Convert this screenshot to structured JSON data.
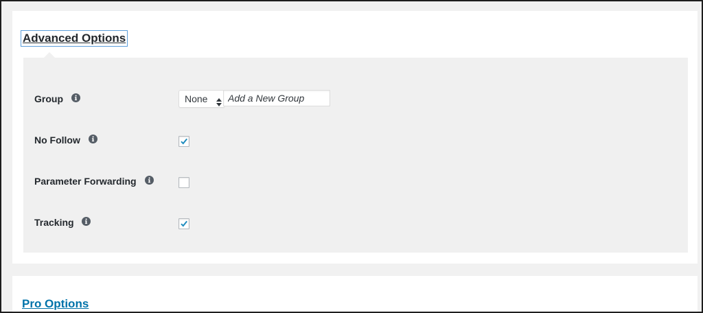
{
  "advanced": {
    "title": "Advanced Options",
    "group": {
      "label": "Group",
      "select_value": "None",
      "new_group_placeholder": "Add a New Group"
    },
    "no_follow": {
      "label": "No Follow",
      "checked": true
    },
    "parameter_forwarding": {
      "label": "Parameter Forwarding",
      "checked": false
    },
    "tracking": {
      "label": "Tracking",
      "checked": true
    }
  },
  "pro": {
    "title": "Pro Options"
  },
  "icons": {
    "info": "info-icon",
    "checkmark": "checkmark-icon",
    "select_arrows": "up-down-arrows-icon"
  },
  "colors": {
    "link": "#0073aa",
    "checkmark": "#1e8cbe",
    "options_background": "#f0f0f0",
    "info_icon": "#555d66"
  }
}
